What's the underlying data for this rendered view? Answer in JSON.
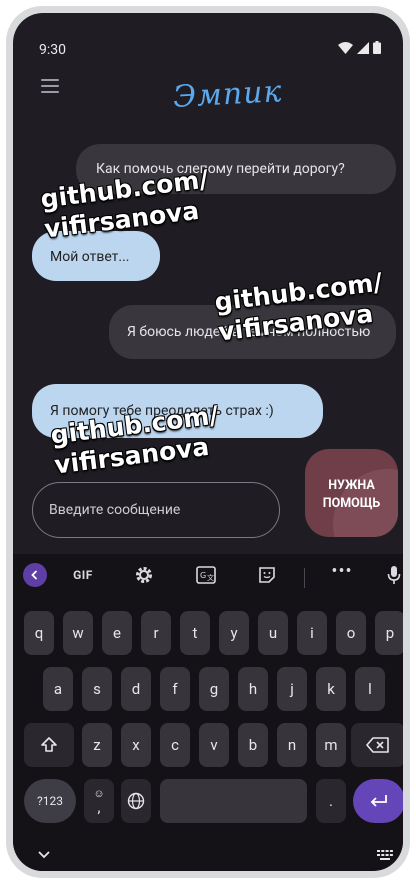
{
  "status": {
    "time": "9:30"
  },
  "app": {
    "logo": "Эмпик"
  },
  "chat": {
    "messages": [
      {
        "from": "user",
        "text": "Как помочь слепому перейти дорогу?"
      },
      {
        "from": "bot",
        "text": "Мой ответ..."
      },
      {
        "from": "user",
        "text": "Я боюсь людей в темном полностью"
      },
      {
        "from": "bot",
        "text": "Я помогу тебе преодолеть страх :)"
      }
    ]
  },
  "watermarks": [
    {
      "line1": "github.com/",
      "line2": "vifirsanova"
    },
    {
      "line1": "github.com/",
      "line2": "vifirsanova"
    },
    {
      "line1": "github.com/",
      "line2": "vifirsanova"
    }
  ],
  "composer": {
    "placeholder": "Введите сообщение"
  },
  "help_button": {
    "line1": "НУЖНА",
    "line2": "ПОМОЩЬ"
  },
  "keyboard": {
    "toolbar": {
      "gif": "GIF",
      "more": "•••"
    },
    "row1": [
      "q",
      "w",
      "e",
      "r",
      "t",
      "y",
      "u",
      "i",
      "o",
      "p"
    ],
    "row2": [
      "a",
      "s",
      "d",
      "f",
      "g",
      "h",
      "j",
      "k",
      "l"
    ],
    "row3": [
      "z",
      "x",
      "c",
      "v",
      "b",
      "n",
      "m"
    ],
    "symbols_key": "?123",
    "comma_key": ",",
    "period_key": "."
  },
  "colors": {
    "accent": "#6546b8",
    "help": "#6f3e49",
    "bubble_in": "#bcd6f0",
    "logo": "#5aa8ee"
  }
}
